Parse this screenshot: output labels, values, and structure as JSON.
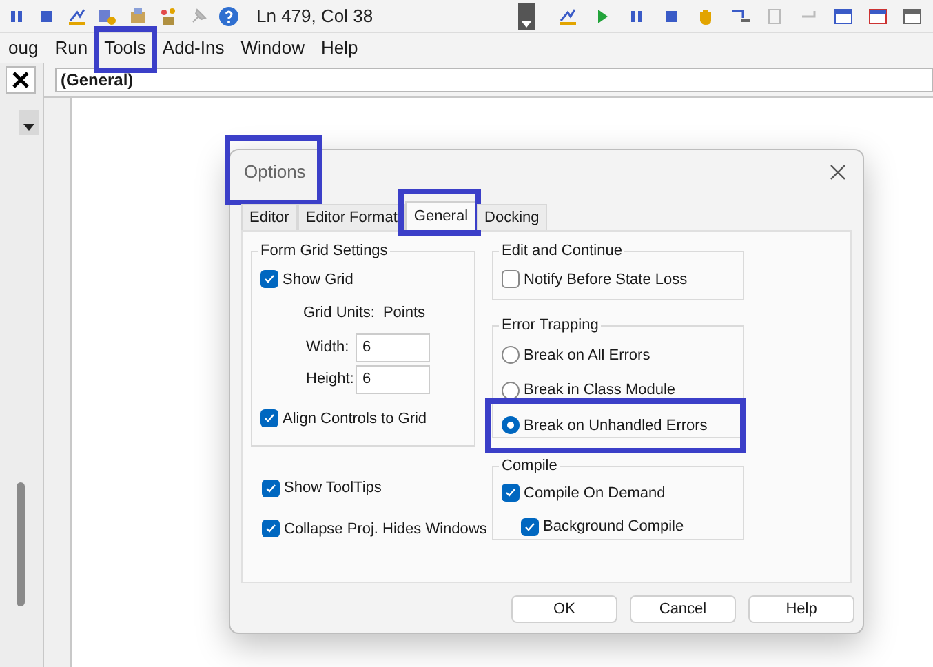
{
  "toolbar": {
    "position": "Ln 479, Col 38"
  },
  "menu": [
    {
      "label": "oug",
      "highlighted": false
    },
    {
      "label": "Run",
      "highlighted": false
    },
    {
      "label": "Tools",
      "highlighted": true
    },
    {
      "label": "Add-Ins",
      "highlighted": false
    },
    {
      "label": "Window",
      "highlighted": false
    },
    {
      "label": "Help",
      "highlighted": false
    }
  ],
  "code_window": {
    "object_box": "(General)"
  },
  "dialog": {
    "title": "Options",
    "highlighted": true,
    "tabs": [
      {
        "label": "Editor",
        "selected": false,
        "highlighted": false
      },
      {
        "label": "Editor Format",
        "selected": false,
        "highlighted": false
      },
      {
        "label": "General",
        "selected": true,
        "highlighted": true
      },
      {
        "label": "Docking",
        "selected": false,
        "highlighted": false
      }
    ],
    "form_grid": {
      "title": "Form Grid Settings",
      "show_grid": {
        "label": "Show Grid",
        "checked": true
      },
      "grid_units_label": "Grid Units:",
      "grid_units": "Points",
      "width": {
        "label": "Width:",
        "value": "6"
      },
      "height": {
        "label": "Height:",
        "value": "6"
      },
      "align": {
        "label": "Align Controls to Grid",
        "checked": true
      }
    },
    "options": [
      {
        "label": "Show ToolTips",
        "checked": true
      },
      {
        "label": "Collapse Proj. Hides Windows",
        "checked": true
      }
    ],
    "edit_continue": {
      "title": "Edit and Continue",
      "items": [
        {
          "label": "Notify Before State Loss",
          "checked": false
        }
      ]
    },
    "error_trapping": {
      "title": "Error Trapping",
      "options": [
        {
          "label": "Break on All Errors",
          "selected": false,
          "highlighted": false
        },
        {
          "label": "Break in Class Module",
          "selected": false,
          "highlighted": false
        },
        {
          "label": "Break on Unhandled Errors",
          "selected": true,
          "highlighted": true
        }
      ]
    },
    "compile": {
      "title": "Compile",
      "items": [
        {
          "label": "Compile On Demand",
          "checked": true,
          "children": [
            {
              "label": "Background Compile",
              "checked": true
            }
          ]
        }
      ]
    },
    "buttons": [
      "OK",
      "Cancel",
      "Help"
    ]
  }
}
